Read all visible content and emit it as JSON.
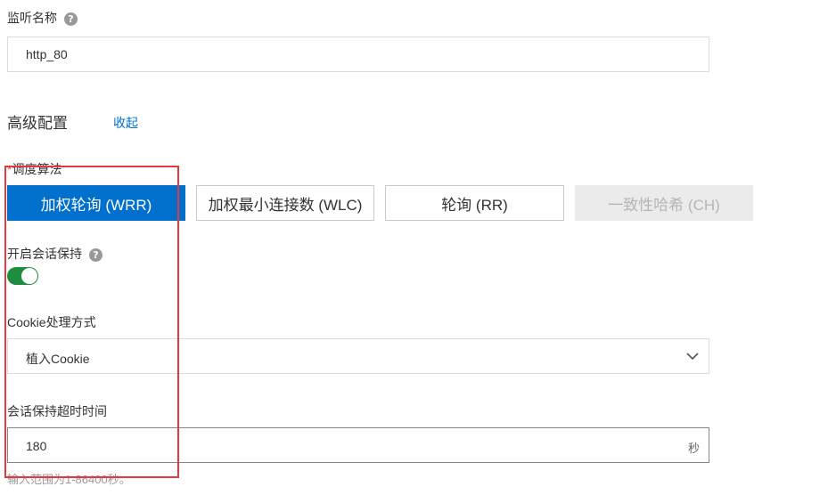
{
  "listener": {
    "name_label": "监听名称",
    "name_help_icon": "?",
    "name_value": "http_80"
  },
  "advanced": {
    "title": "高级配置",
    "collapse_link": "收起"
  },
  "scheduler": {
    "label": "调度算法",
    "required_marker": "*",
    "options": [
      {
        "label": "加权轮询 (WRR)",
        "state": "selected"
      },
      {
        "label": "加权最小连接数 (WLC)",
        "state": "normal"
      },
      {
        "label": "轮询 (RR)",
        "state": "normal"
      },
      {
        "label": "一致性哈希 (CH)",
        "state": "disabled"
      }
    ]
  },
  "session": {
    "label": "开启会话保持",
    "help_icon": "?",
    "enabled": true
  },
  "cookie": {
    "label": "Cookie处理方式",
    "selected": "植入Cookie",
    "dropdown_icon": "chevron-down-icon"
  },
  "timeout": {
    "label": "会话保持超时时间",
    "value": "180",
    "unit": "秒",
    "hint": "输入范围为1-86400秒。"
  },
  "colors": {
    "primary": "#0070cc",
    "toggle_on": "#1e8e3e",
    "highlight": "#e0393e",
    "link": "#0070cc"
  }
}
